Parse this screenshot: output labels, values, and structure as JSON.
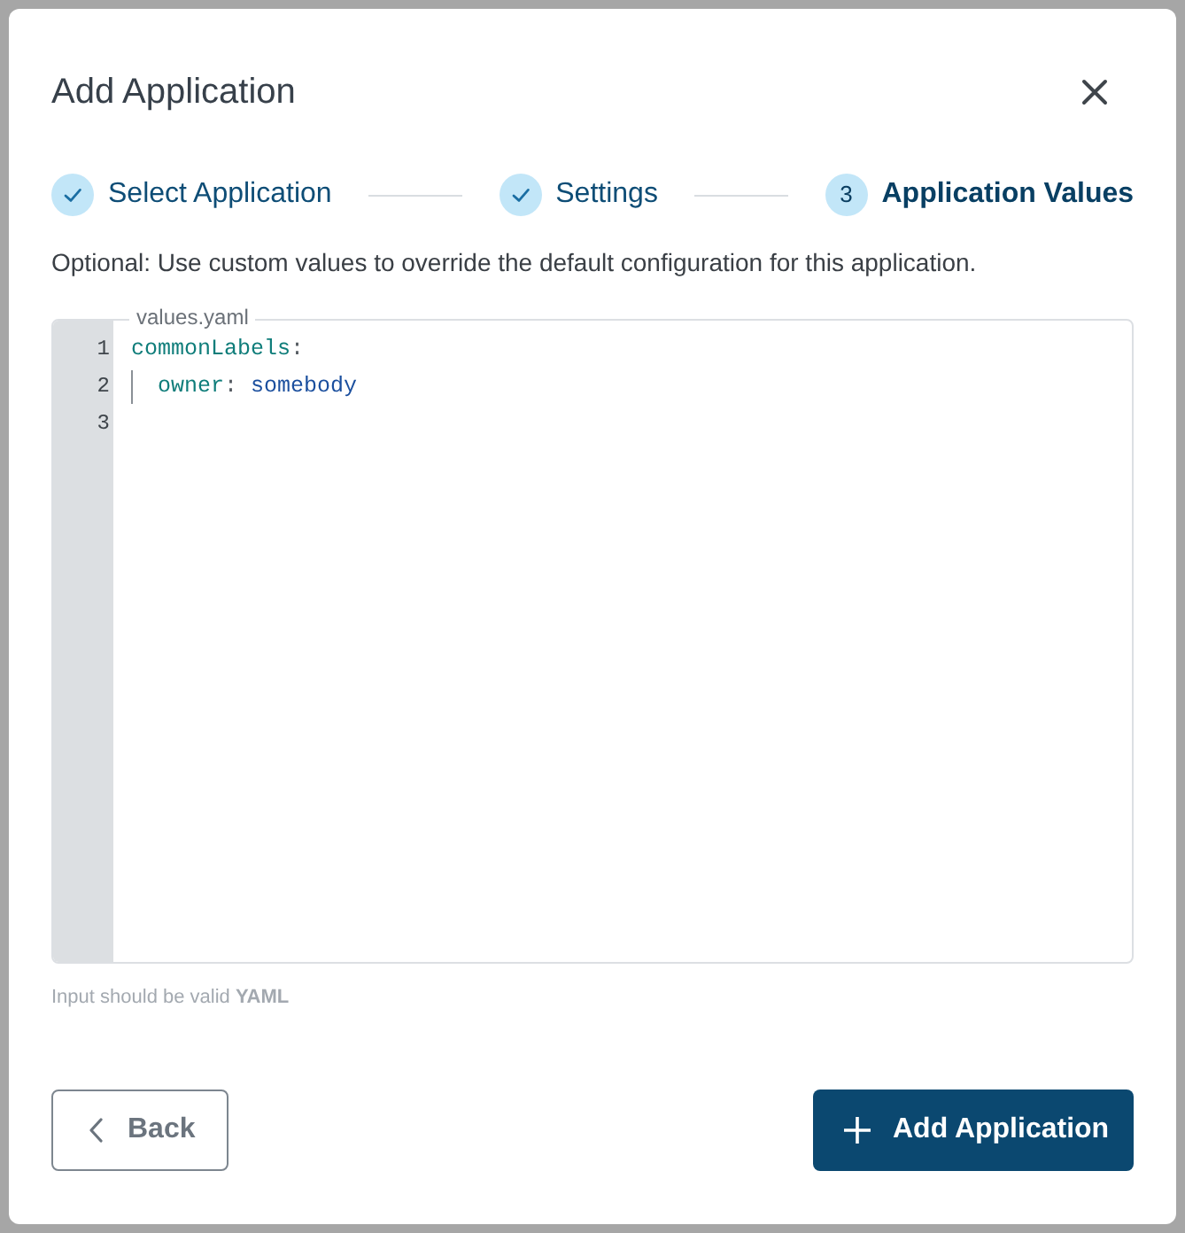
{
  "window": {
    "title": "Add Application"
  },
  "steps": [
    {
      "label": "Select Application",
      "completed": true,
      "selected": false
    },
    {
      "label": "Settings",
      "completed": true,
      "selected": false
    },
    {
      "label": "Application Values",
      "number": "3",
      "completed": false,
      "selected": true
    }
  ],
  "description": "Optional: Use custom values to override the default configuration for this application.",
  "editor": {
    "legend": "values.yaml",
    "lines": [
      {
        "number": "1",
        "tokens": [
          {
            "kind": "key",
            "text": "commonLabels"
          },
          {
            "kind": "punct",
            "text": ":"
          }
        ]
      },
      {
        "number": "2",
        "tokens": [
          {
            "kind": "indent"
          },
          {
            "kind": "key",
            "text": "owner"
          },
          {
            "kind": "punct",
            "text": ": "
          },
          {
            "kind": "value",
            "text": "somebody"
          }
        ]
      },
      {
        "number": "3"
      }
    ]
  },
  "hint": "Input should be valid **YAML**",
  "buttons": [
    {
      "kind": "back",
      "label": "Back"
    },
    {
      "kind": "primary",
      "label": "Add Application"
    }
  ]
}
